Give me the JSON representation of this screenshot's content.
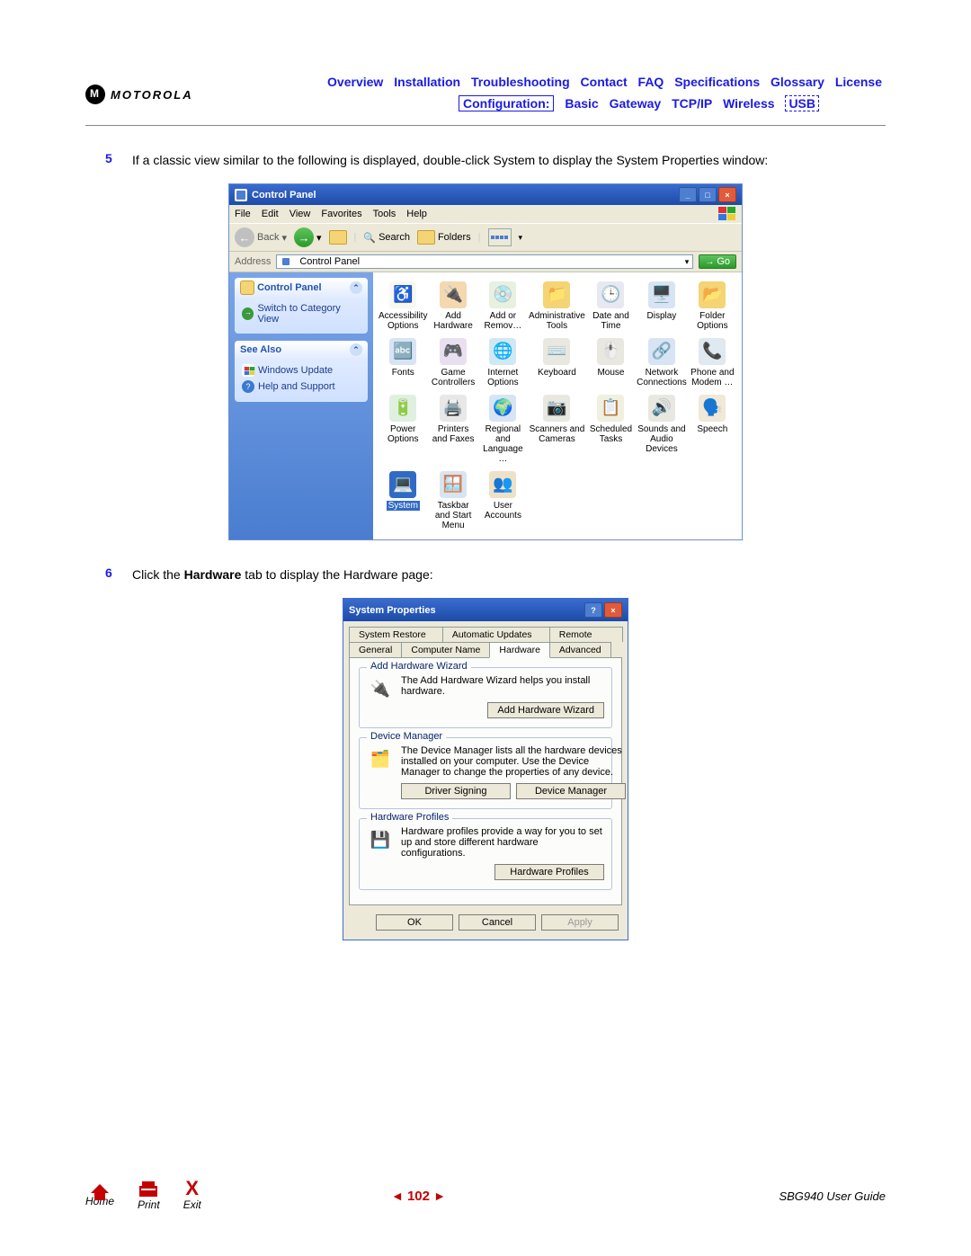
{
  "header": {
    "brand": "MOTOROLA",
    "nav_row1": [
      "Overview",
      "Installation",
      "Troubleshooting",
      "Contact",
      "FAQ",
      "Specifications",
      "Glossary",
      "License"
    ],
    "nav_row2_boxed": "Configuration:",
    "nav_row2_links": [
      "Basic",
      "Gateway",
      "TCP/IP",
      "Wireless"
    ],
    "nav_row2_dashed": "USB"
  },
  "steps": {
    "s5_num": "5",
    "s5_text": "If a classic view similar to the following is displayed, double-click System to display the System Properties window:",
    "s6_num": "6",
    "s6_pre": "Click the ",
    "s6_bold": "Hardware",
    "s6_post": " tab to display the Hardware page:"
  },
  "cp": {
    "title": "Control Panel",
    "menu": [
      "File",
      "Edit",
      "View",
      "Favorites",
      "Tools",
      "Help"
    ],
    "back": "Back",
    "search": "Search",
    "folders": "Folders",
    "addr_label": "Address",
    "addr_value": "Control Panel",
    "go": "Go",
    "side_hdr1": "Control Panel",
    "side_link1": "Switch to Category View",
    "side_hdr2": "See Also",
    "side_link2": "Windows Update",
    "side_link3": "Help and Support",
    "items": [
      {
        "label": "Accessibility Options",
        "emoji": "♿",
        "bg": "#f8f8f0"
      },
      {
        "label": "Add Hardware",
        "emoji": "🔌",
        "bg": "#f4d8b0"
      },
      {
        "label": "Add or Remov…",
        "emoji": "💿",
        "bg": "#e8f0e0"
      },
      {
        "label": "Administrative Tools",
        "emoji": "📁",
        "bg": "#f4d474"
      },
      {
        "label": "Date and Time",
        "emoji": "🕒",
        "bg": "#e8e8f0"
      },
      {
        "label": "Display",
        "emoji": "🖥️",
        "bg": "#d8e4f4"
      },
      {
        "label": "Folder Options",
        "emoji": "📂",
        "bg": "#f4d474"
      },
      {
        "label": "Fonts",
        "emoji": "🔤",
        "bg": "#d8e4f4"
      },
      {
        "label": "Game Controllers",
        "emoji": "🎮",
        "bg": "#e8e0f0"
      },
      {
        "label": "Internet Options",
        "emoji": "🌐",
        "bg": "#d0e8f4"
      },
      {
        "label": "Keyboard",
        "emoji": "⌨️",
        "bg": "#e8e8e0"
      },
      {
        "label": "Mouse",
        "emoji": "🖱️",
        "bg": "#e8e8e0"
      },
      {
        "label": "Network Connections",
        "emoji": "🔗",
        "bg": "#d8e4f4"
      },
      {
        "label": "Phone and Modem …",
        "emoji": "📞",
        "bg": "#e0e8f0"
      },
      {
        "label": "Power Options",
        "emoji": "🔋",
        "bg": "#e0f0e0"
      },
      {
        "label": "Printers and Faxes",
        "emoji": "🖨️",
        "bg": "#e8e8e8"
      },
      {
        "label": "Regional and Language …",
        "emoji": "🌍",
        "bg": "#d8e4f4"
      },
      {
        "label": "Scanners and Cameras",
        "emoji": "📷",
        "bg": "#e8e8e0"
      },
      {
        "label": "Scheduled Tasks",
        "emoji": "📋",
        "bg": "#f0f0e0"
      },
      {
        "label": "Sounds and Audio Devices",
        "emoji": "🔊",
        "bg": "#e8e8e0"
      },
      {
        "label": "Speech",
        "emoji": "🗣️",
        "bg": "#f0e8d8"
      },
      {
        "label": "System",
        "emoji": "💻",
        "bg": "#316ac5",
        "selected": true
      },
      {
        "label": "Taskbar and Start Menu",
        "emoji": "🪟",
        "bg": "#d8e4f4"
      },
      {
        "label": "User Accounts",
        "emoji": "👥",
        "bg": "#f0e0c8"
      }
    ]
  },
  "sp": {
    "title": "System Properties",
    "tabs_row1": [
      "System Restore",
      "Automatic Updates",
      "Remote"
    ],
    "tabs_row2": [
      "General",
      "Computer Name",
      "Hardware",
      "Advanced"
    ],
    "active_tab": "Hardware",
    "g1_title": "Add Hardware Wizard",
    "g1_text": "The Add Hardware Wizard helps you install hardware.",
    "g1_btn": "Add Hardware Wizard",
    "g2_title": "Device Manager",
    "g2_text": "The Device Manager lists all the hardware devices installed on your computer. Use the Device Manager to change the properties of any device.",
    "g2_btn1": "Driver Signing",
    "g2_btn2": "Device Manager",
    "g3_title": "Hardware Profiles",
    "g3_text": "Hardware profiles provide a way for you to set up and store different hardware configurations.",
    "g3_btn": "Hardware Profiles",
    "ok": "OK",
    "cancel": "Cancel",
    "apply": "Apply"
  },
  "footer": {
    "home": "Home",
    "print": "Print",
    "exit": "Exit",
    "page": "102",
    "guide": "SBG940 User Guide"
  }
}
